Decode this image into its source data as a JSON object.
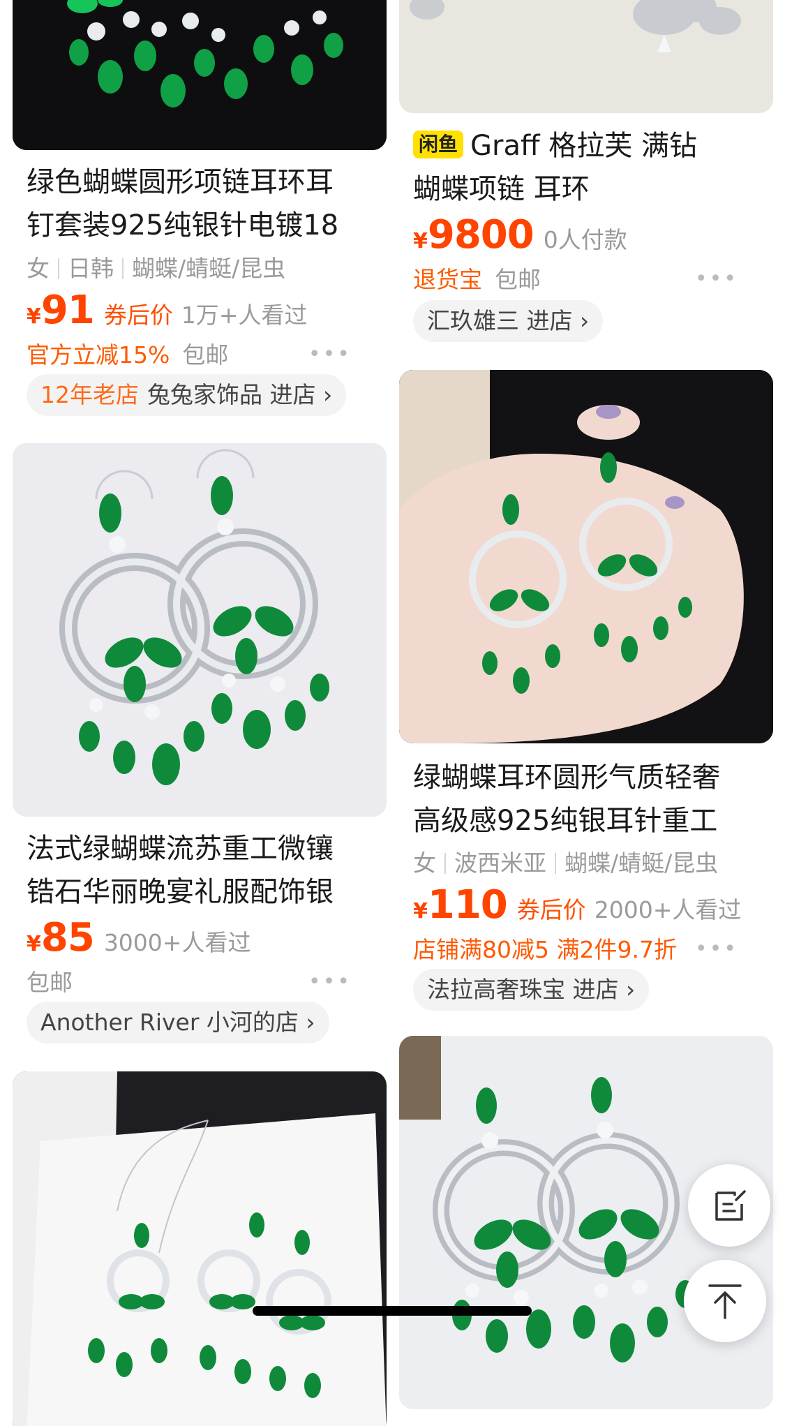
{
  "products": [
    {
      "title_line1": "绿色蝴蝶圆形项链耳环耳",
      "title_line2": "钉套装925纯银针电镀18",
      "tags": [
        "女",
        "日韩",
        "蝴蝶/蜻蜓/昆虫"
      ],
      "currency": "¥",
      "price": "91",
      "coupon": "券后价",
      "views": "1万+人看过",
      "promo": "官方立减15%",
      "shipping": "包邮",
      "store_age": "12年老店",
      "store": "兔兔家饰品 进店",
      "store_chevron": "›"
    },
    {
      "badge": "闲鱼",
      "title_line1": "Graff 格拉芙 满钻",
      "title_line2": "蝴蝶项链 耳环",
      "currency": "¥",
      "price": "9800",
      "views": "0人付款",
      "promo": "退货宝",
      "shipping": "包邮",
      "store": "汇玖雄三 进店",
      "store_chevron": "›"
    },
    {
      "title_line1": "法式绿蝴蝶流苏重工微镶",
      "title_line2": "锆石华丽晚宴礼服配饰银",
      "currency": "¥",
      "price": "85",
      "views": "3000+人看过",
      "shipping": "包邮",
      "store": "Another River 小河的店",
      "store_chevron": "›"
    },
    {
      "title_line1": "绿蝴蝶耳环圆形气质轻奢",
      "title_line2": "高级感925纯银耳针重工",
      "tags": [
        "女",
        "波西米亚",
        "蝴蝶/蜻蜓/昆虫"
      ],
      "currency": "¥",
      "price": "110",
      "coupon": "券后价",
      "views": "2000+人看过",
      "promo": "店铺满80减5  满2件9.7折",
      "store": "法拉高奢珠宝 进店",
      "store_chevron": "›"
    }
  ],
  "more_label": "•••",
  "colors": {
    "price": "#ff4400",
    "promo": "#ff5a00",
    "emerald": "#0f8a3a",
    "badge": "#ffe100"
  },
  "icons": {
    "feedback": "edit-note-icon",
    "back_to_top": "arrow-up-icon"
  }
}
